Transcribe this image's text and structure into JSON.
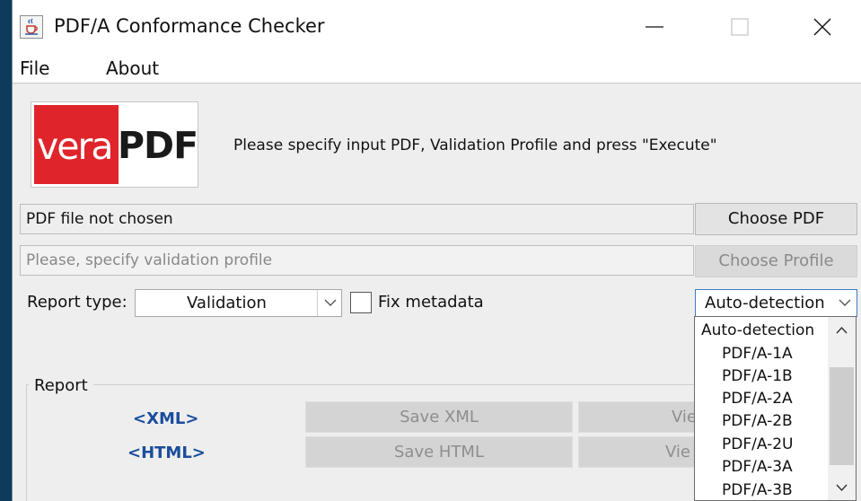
{
  "window": {
    "title": "PDF/A Conformance Checker",
    "icons": {
      "app": "java-cup-icon",
      "minimize": "minimize-icon",
      "maximize": "maximize-icon",
      "close": "close-icon"
    }
  },
  "menu": {
    "file": "File",
    "about": "About"
  },
  "logo": {
    "part1": "vera",
    "part2": "PDF",
    "accent_color": "#e0242b"
  },
  "instruction": "Please specify input PDF, Validation Profile and press \"Execute\"",
  "pdf_field": {
    "value": "PDF file not chosen"
  },
  "choose_pdf_label": "Choose PDF",
  "profile_field": {
    "placeholder": "Please, specify validation profile"
  },
  "choose_profile_label": "Choose Profile",
  "report_type": {
    "label": "Report type:",
    "selected": "Validation"
  },
  "fix_metadata": {
    "label": "Fix metadata",
    "checked": false
  },
  "flavour": {
    "selected": "Auto-detection",
    "options": [
      "Auto-detection",
      "PDF/A-1A",
      "PDF/A-1B",
      "PDF/A-2A",
      "PDF/A-2B",
      "PDF/A-2U",
      "PDF/A-3A",
      "PDF/A-3B"
    ]
  },
  "report": {
    "legend": "Report",
    "xml_link": "<XML>",
    "html_link": "<HTML>",
    "save_xml": "Save XML",
    "save_html": "Save HTML",
    "view_xml_partial": "Vie",
    "view_html_partial": "Vie",
    "link_color": "#1a4d9c"
  }
}
